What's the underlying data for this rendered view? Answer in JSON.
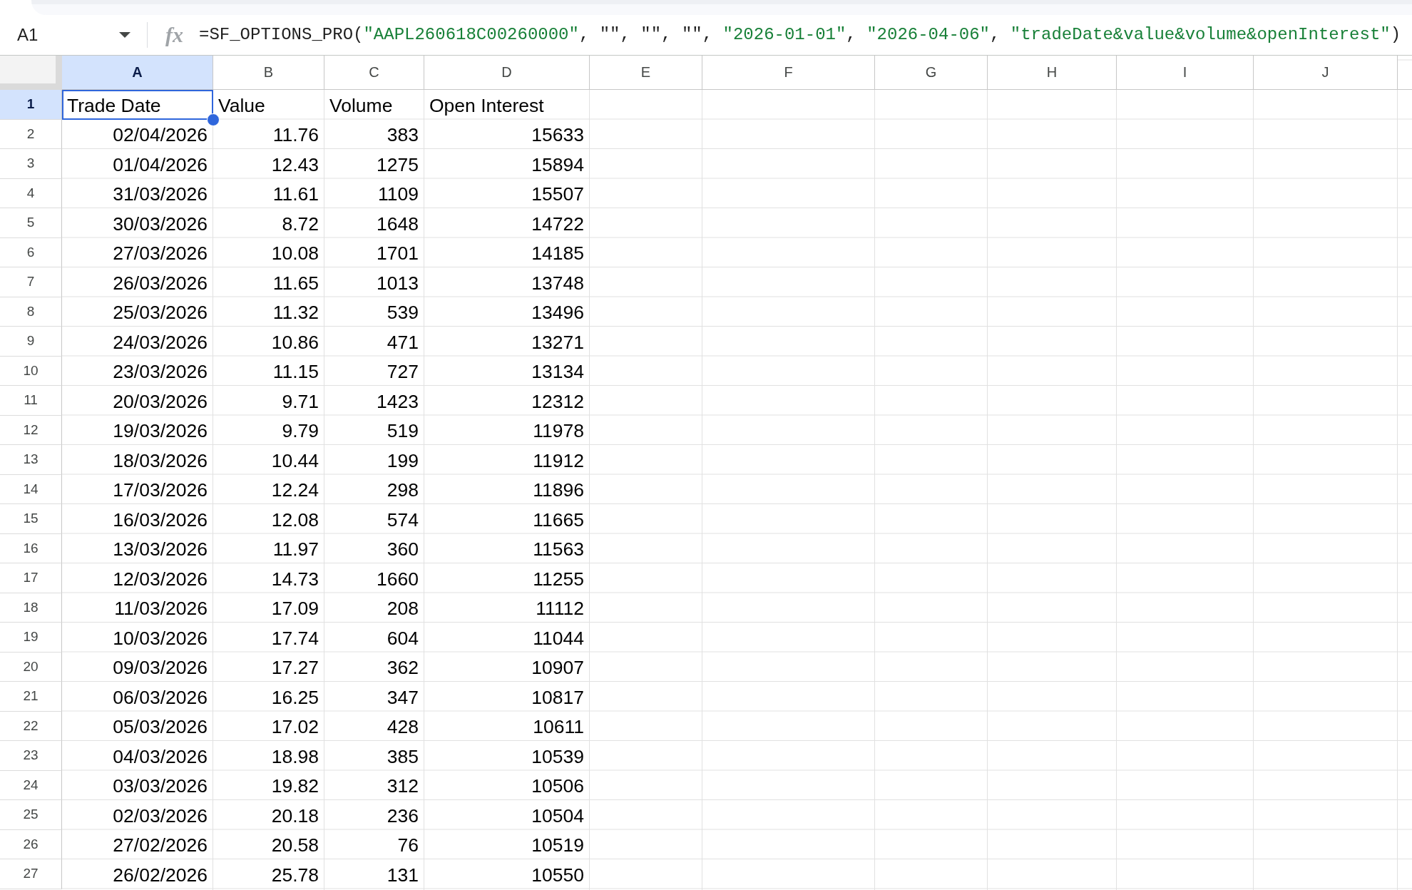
{
  "name_box": {
    "value": "A1"
  },
  "formula_bar": {
    "fx_label": "fx",
    "tokens": [
      {
        "kind": "code",
        "text": "=SF_OPTIONS_PRO("
      },
      {
        "kind": "string",
        "text": "\"AAPL260618C00260000\""
      },
      {
        "kind": "code",
        "text": ", \"\", \"\", \"\", "
      },
      {
        "kind": "string",
        "text": "\"2026-01-01\""
      },
      {
        "kind": "code",
        "text": ", "
      },
      {
        "kind": "string",
        "text": "\"2026-04-06\""
      },
      {
        "kind": "code",
        "text": ", "
      },
      {
        "kind": "string",
        "text": "\"tradeDate&value&volume&openInterest\""
      },
      {
        "kind": "code",
        "text": ")"
      }
    ]
  },
  "columns": [
    {
      "label": "A",
      "selected": true
    },
    {
      "label": "B",
      "selected": false
    },
    {
      "label": "C",
      "selected": false
    },
    {
      "label": "D",
      "selected": false
    },
    {
      "label": "E",
      "selected": false
    },
    {
      "label": "F",
      "selected": false
    },
    {
      "label": "G",
      "selected": false
    },
    {
      "label": "H",
      "selected": false
    },
    {
      "label": "I",
      "selected": false
    },
    {
      "label": "J",
      "selected": false
    }
  ],
  "rows": [
    {
      "number": "1",
      "selected": true,
      "kind": "header",
      "cells": [
        "Trade Date",
        "Value",
        "Volume",
        "Open Interest"
      ]
    },
    {
      "number": "2",
      "selected": false,
      "kind": "data",
      "cells": [
        "02/04/2026",
        "11.76",
        "383",
        "15633"
      ]
    },
    {
      "number": "3",
      "selected": false,
      "kind": "data",
      "cells": [
        "01/04/2026",
        "12.43",
        "1275",
        "15894"
      ]
    },
    {
      "number": "4",
      "selected": false,
      "kind": "data",
      "cells": [
        "31/03/2026",
        "11.61",
        "1109",
        "15507"
      ]
    },
    {
      "number": "5",
      "selected": false,
      "kind": "data",
      "cells": [
        "30/03/2026",
        "8.72",
        "1648",
        "14722"
      ]
    },
    {
      "number": "6",
      "selected": false,
      "kind": "data",
      "cells": [
        "27/03/2026",
        "10.08",
        "1701",
        "14185"
      ]
    },
    {
      "number": "7",
      "selected": false,
      "kind": "data",
      "cells": [
        "26/03/2026",
        "11.65",
        "1013",
        "13748"
      ]
    },
    {
      "number": "8",
      "selected": false,
      "kind": "data",
      "cells": [
        "25/03/2026",
        "11.32",
        "539",
        "13496"
      ]
    },
    {
      "number": "9",
      "selected": false,
      "kind": "data",
      "cells": [
        "24/03/2026",
        "10.86",
        "471",
        "13271"
      ]
    },
    {
      "number": "10",
      "selected": false,
      "kind": "data",
      "cells": [
        "23/03/2026",
        "11.15",
        "727",
        "13134"
      ]
    },
    {
      "number": "11",
      "selected": false,
      "kind": "data",
      "cells": [
        "20/03/2026",
        "9.71",
        "1423",
        "12312"
      ]
    },
    {
      "number": "12",
      "selected": false,
      "kind": "data",
      "cells": [
        "19/03/2026",
        "9.79",
        "519",
        "11978"
      ]
    },
    {
      "number": "13",
      "selected": false,
      "kind": "data",
      "cells": [
        "18/03/2026",
        "10.44",
        "199",
        "11912"
      ]
    },
    {
      "number": "14",
      "selected": false,
      "kind": "data",
      "cells": [
        "17/03/2026",
        "12.24",
        "298",
        "11896"
      ]
    },
    {
      "number": "15",
      "selected": false,
      "kind": "data",
      "cells": [
        "16/03/2026",
        "12.08",
        "574",
        "11665"
      ]
    },
    {
      "number": "16",
      "selected": false,
      "kind": "data",
      "cells": [
        "13/03/2026",
        "11.97",
        "360",
        "11563"
      ]
    },
    {
      "number": "17",
      "selected": false,
      "kind": "data",
      "cells": [
        "12/03/2026",
        "14.73",
        "1660",
        "11255"
      ]
    },
    {
      "number": "18",
      "selected": false,
      "kind": "data",
      "cells": [
        "11/03/2026",
        "17.09",
        "208",
        "11112"
      ]
    },
    {
      "number": "19",
      "selected": false,
      "kind": "data",
      "cells": [
        "10/03/2026",
        "17.74",
        "604",
        "11044"
      ]
    },
    {
      "number": "20",
      "selected": false,
      "kind": "data",
      "cells": [
        "09/03/2026",
        "17.27",
        "362",
        "10907"
      ]
    },
    {
      "number": "21",
      "selected": false,
      "kind": "data",
      "cells": [
        "06/03/2026",
        "16.25",
        "347",
        "10817"
      ]
    },
    {
      "number": "22",
      "selected": false,
      "kind": "data",
      "cells": [
        "05/03/2026",
        "17.02",
        "428",
        "10611"
      ]
    },
    {
      "number": "23",
      "selected": false,
      "kind": "data",
      "cells": [
        "04/03/2026",
        "18.98",
        "385",
        "10539"
      ]
    },
    {
      "number": "24",
      "selected": false,
      "kind": "data",
      "cells": [
        "03/03/2026",
        "19.82",
        "312",
        "10506"
      ]
    },
    {
      "number": "25",
      "selected": false,
      "kind": "data",
      "cells": [
        "02/03/2026",
        "20.18",
        "236",
        "10504"
      ]
    },
    {
      "number": "26",
      "selected": false,
      "kind": "data",
      "cells": [
        "27/02/2026",
        "20.58",
        "76",
        "10519"
      ]
    },
    {
      "number": "27",
      "selected": false,
      "kind": "data",
      "cells": [
        "26/02/2026",
        "25.78",
        "131",
        "10550"
      ]
    }
  ]
}
